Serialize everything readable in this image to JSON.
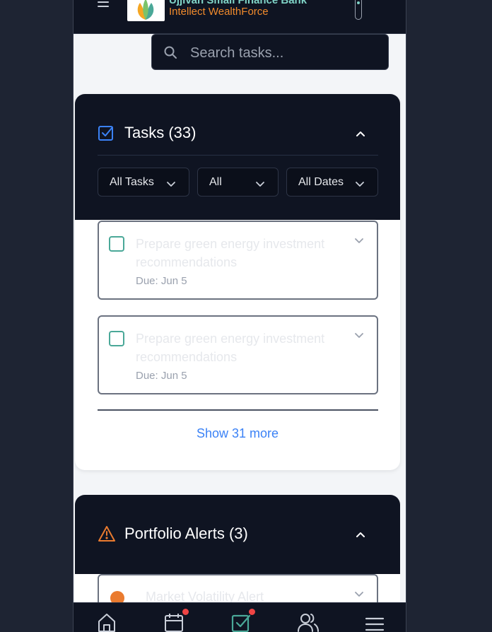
{
  "header": {
    "brand_title": "Ujjivan Small Finance Bank",
    "brand_subtitle": "Intellect WealthForce"
  },
  "search": {
    "placeholder": "Search tasks..."
  },
  "tasks": {
    "title": "Tasks (33)",
    "filters": [
      "All Tasks",
      "All",
      "All Dates"
    ],
    "items": [
      {
        "title": "Prepare green energy investment recommendations",
        "due": "Due: Jun 5"
      },
      {
        "title": "Prepare green energy investment recommendations",
        "due": "Due: Jun 5"
      }
    ],
    "show_more": "Show 31 more"
  },
  "alerts": {
    "title": "Portfolio Alerts (3)",
    "items": [
      {
        "title": "Market Volatility Alert"
      }
    ]
  },
  "colors": {
    "header_bg": "#0f1422",
    "brand_title": "#7fd3c6",
    "brand_subtitle": "#f08a2c",
    "accent_blue": "#3b82f6",
    "alert_orange": "#ea7b2f",
    "badge_red": "#ef4444",
    "checkbox_teal": "#4aa898"
  },
  "bottom_nav": {
    "items": [
      "home-icon",
      "calendar-icon",
      "tasks-icon",
      "clients-icon",
      "menu-icon"
    ],
    "badges_on": [
      "calendar-icon",
      "tasks-icon"
    ],
    "active": "tasks-icon"
  }
}
